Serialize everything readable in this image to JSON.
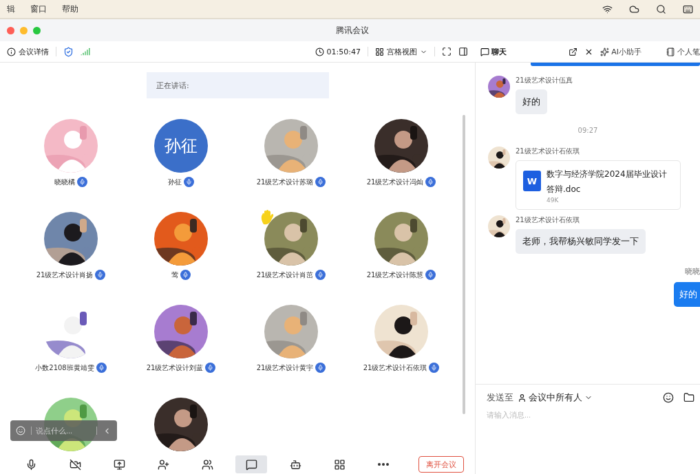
{
  "menu_bar": {
    "items": [
      "辑",
      "窗口",
      "帮助"
    ]
  },
  "window": {
    "title": "腾讯会议"
  },
  "toolbar": {
    "details": "会议详情",
    "timer": "01:50:47",
    "view": "宫格视图"
  },
  "side_tabs": [
    {
      "label": "聊天",
      "selected": true,
      "kind": "chat"
    },
    {
      "label": "AI小助手",
      "selected": false,
      "kind": "ai"
    },
    {
      "label": "个人笔",
      "selected": false,
      "kind": "note"
    }
  ],
  "speaking": {
    "label": "正在讲话:"
  },
  "participants": [
    {
      "name": "晓晓橘",
      "kind": "picture",
      "hand_raised": false
    },
    {
      "name": "孙征",
      "kind": "text",
      "avatar_text": "孙征",
      "hand_raised": false
    },
    {
      "name": "21级艺术设计苏璐",
      "kind": "picture",
      "hand_raised": false
    },
    {
      "name": "21级艺术设计冯灿",
      "kind": "picture",
      "hand_raised": false
    },
    {
      "name": "21级艺术设计肖扬",
      "kind": "picture",
      "hand_raised": false
    },
    {
      "name": "莺",
      "kind": "picture",
      "hand_raised": false
    },
    {
      "name": "21级艺术设计肖茁",
      "kind": "picture",
      "hand_raised": true
    },
    {
      "name": "21级艺术设计陈慧",
      "kind": "picture",
      "hand_raised": false
    },
    {
      "name": "小数2108班黄靖雯",
      "kind": "picture",
      "hand_raised": false
    },
    {
      "name": "21级艺术设计刘蓝",
      "kind": "picture",
      "hand_raised": false
    },
    {
      "name": "21级艺术设计黄宇",
      "kind": "picture",
      "hand_raised": false
    },
    {
      "name": "21级艺术设计石依琪",
      "kind": "picture",
      "hand_raised": false
    },
    {
      "kind": "picture",
      "hand_raised": false
    },
    {
      "kind": "picture",
      "hand_raised": false
    }
  ],
  "comment_bar": {
    "placeholder": "说点什么..."
  },
  "chat": [
    {
      "kind": "text",
      "sender": "21级艺术设计伍真",
      "text": "好的"
    },
    {
      "kind": "time",
      "text": "09:27"
    },
    {
      "kind": "file",
      "sender": "21级艺术设计石依琪",
      "file_icon": "W",
      "file_name": "数字与经济学院2024届毕业设计答辩.doc",
      "size": "49K"
    },
    {
      "kind": "text",
      "sender": "21级艺术设计石依琪",
      "text": "老师，我帮杨兴敏同学发一下"
    },
    {
      "kind": "self",
      "sender": "晓晓",
      "text": "好的"
    }
  ],
  "composer": {
    "send_to_label": "发送至",
    "recipient": "会议中所有人",
    "placeholder": "请输入消息..."
  },
  "bottom_tools": [
    {
      "kind": "mic",
      "selected": false
    },
    {
      "kind": "camera",
      "selected": false
    },
    {
      "kind": "share",
      "selected": false
    },
    {
      "kind": "invite",
      "selected": false
    },
    {
      "kind": "members",
      "selected": false
    },
    {
      "kind": "chat",
      "selected": true
    },
    {
      "kind": "bot",
      "selected": false
    },
    {
      "kind": "apps",
      "selected": false
    },
    {
      "kind": "more",
      "selected": false
    }
  ],
  "leave_button": {
    "label": "离开会议"
  }
}
